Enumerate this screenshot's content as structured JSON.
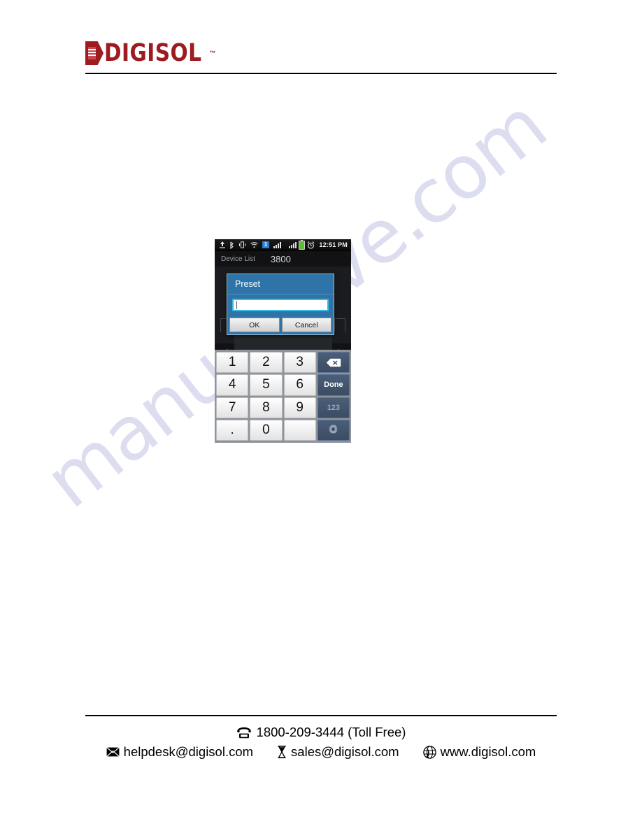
{
  "document": {
    "brand": {
      "name": "DIGISOL",
      "trademark": "™",
      "color": "#9e1b20"
    },
    "watermark": "manualslive.com"
  },
  "phone_screenshot": {
    "status_bar": {
      "time": "12:51 PM",
      "notification_count": "1",
      "icons": [
        "upload-icon",
        "bluetooth-icon",
        "vibrate-icon",
        "wifi-icon",
        "notification-badge",
        "signal-bars-icon",
        "signal-strength-icon",
        "battery-icon",
        "alarm-clock-icon"
      ],
      "battery_color": "#5fbf2e"
    },
    "app": {
      "device_list_label": "Device List",
      "device_value": "3800",
      "nav_back_icon": "arrow-left-icon",
      "nav_forward_icon": "arrow-right-icon"
    },
    "dialog": {
      "title": "Preset",
      "input_value": "",
      "ok_label": "OK",
      "cancel_label": "Cancel",
      "header_color": "#2e74a8",
      "input_border_color": "#37b7e5"
    },
    "keyboard": {
      "rows": [
        [
          "1",
          "2",
          "3"
        ],
        [
          "4",
          "5",
          "6"
        ],
        [
          "7",
          "8",
          "9"
        ],
        [
          ".",
          "0",
          ""
        ]
      ],
      "function_keys": [
        {
          "name": "backspace-key",
          "label": "⌫",
          "icon": "backspace-icon"
        },
        {
          "name": "done-key",
          "label": "Done",
          "icon": ""
        },
        {
          "name": "symbols-key",
          "label": "123",
          "icon": ""
        },
        {
          "name": "settings-key",
          "label": "",
          "icon": "gear-icon"
        }
      ],
      "key_face_color": "#ffffff",
      "fn_key_color": "#3b4c63"
    }
  },
  "footer": {
    "phone_icon": "telephone-icon",
    "phone": "1800-209-3444 (Toll Free)",
    "helpdesk_icon": "envelope-icon",
    "helpdesk": "helpdesk@digisol.com",
    "sales_icon": "hourglass-icon",
    "sales": "sales@digisol.com",
    "web_icon": "globe-icon",
    "web": "www.digisol.com"
  }
}
